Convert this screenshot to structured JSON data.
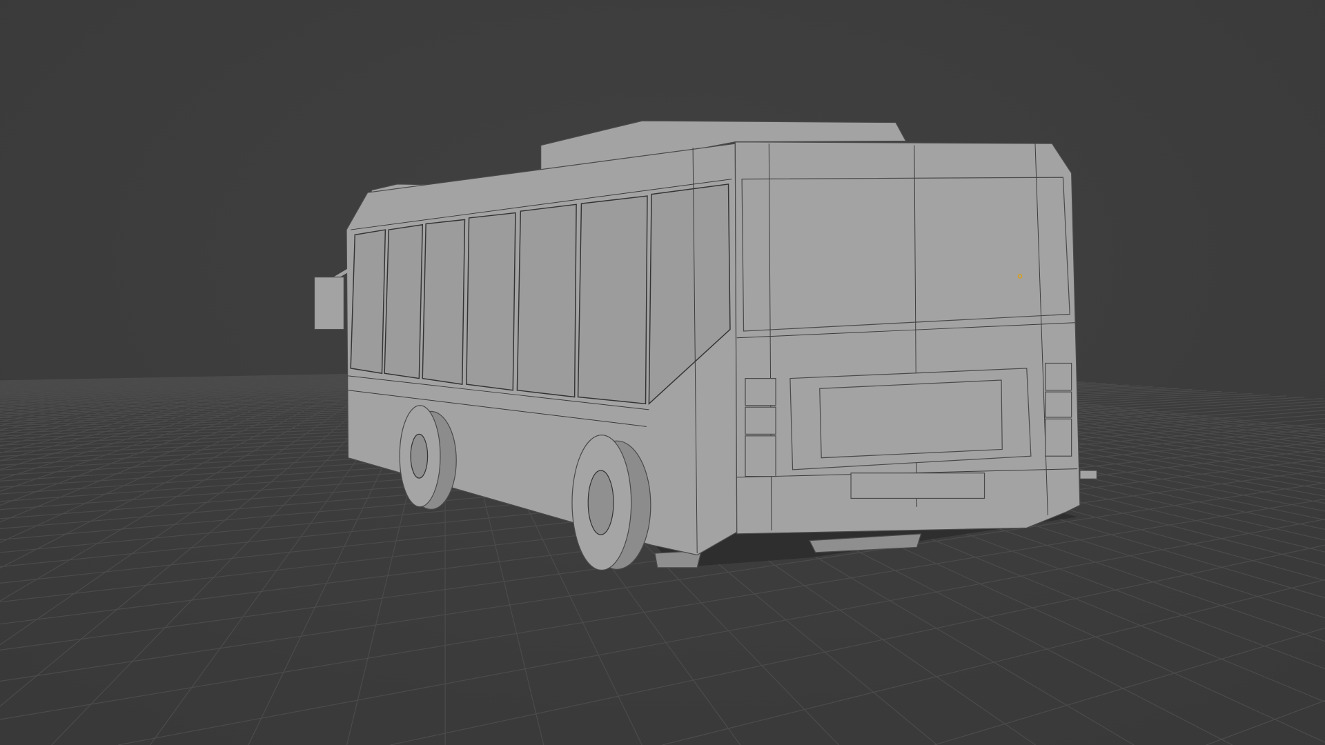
{
  "viewport": {
    "background_color": "#3d3d3d",
    "grid_color": "#4b4b4b",
    "mesh_color": "#a3a3a3",
    "origin_color": "#e0a000"
  }
}
